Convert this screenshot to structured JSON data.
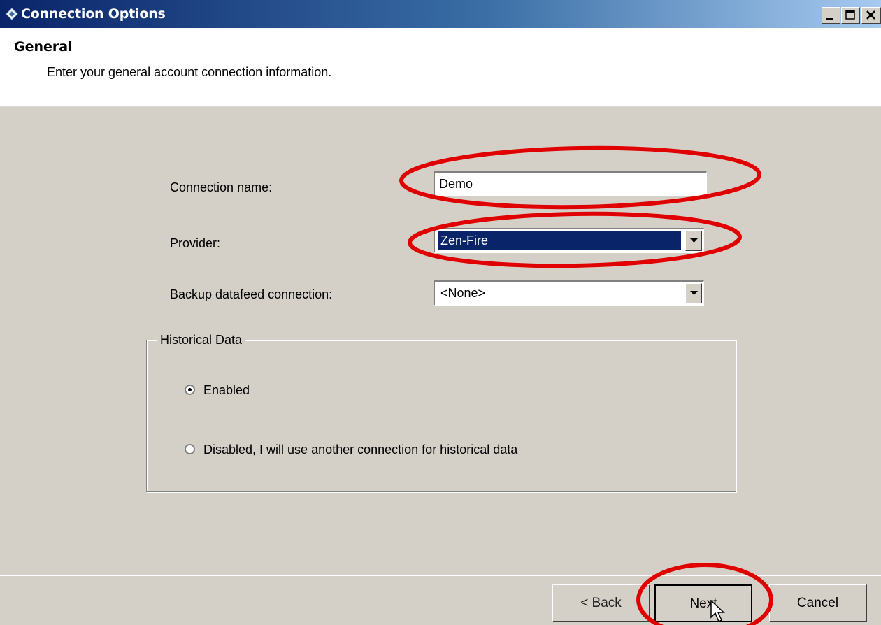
{
  "window": {
    "title": "Connection Options",
    "icon": "diamond-app-icon",
    "controls": [
      "minimize-icon",
      "maximize-icon",
      "close-icon"
    ]
  },
  "header": {
    "title": "General",
    "subtitle": "Enter your general account connection information."
  },
  "form": {
    "connection_name": {
      "label": "Connection name:",
      "value": "Demo"
    },
    "provider": {
      "label": "Provider:",
      "selected": "Zen-Fire"
    },
    "backup": {
      "label": "Backup datafeed connection:",
      "selected": "<None>"
    }
  },
  "historical": {
    "legend": "Historical Data",
    "options": [
      {
        "label": "Enabled",
        "checked": true
      },
      {
        "label": "Disabled, I will use another connection for historical data",
        "checked": false
      }
    ]
  },
  "buttons": {
    "back": "< Back",
    "next": "Next",
    "cancel": "Cancel"
  },
  "colors": {
    "highlight_ellipse": "#e00000",
    "selection": "#0a246a",
    "titlebar": "#0a246a",
    "dialog_face": "#d4d0c8"
  }
}
